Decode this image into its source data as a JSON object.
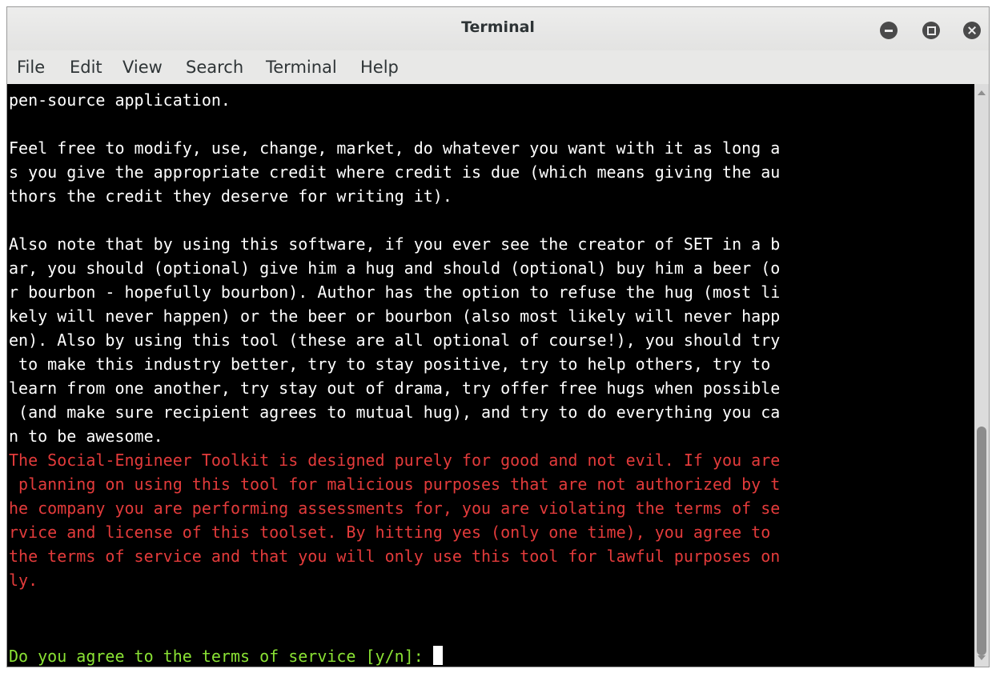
{
  "window": {
    "title": "Terminal"
  },
  "menu": {
    "items": [
      "File",
      "Edit",
      "View",
      "Search",
      "Terminal",
      "Help"
    ]
  },
  "terminal": {
    "colors": {
      "background": "#000000",
      "text": "#ffffff",
      "warning": "#e33b3b",
      "prompt": "#8ae234"
    },
    "lines": [
      "pen-source application.",
      "",
      "Feel free to modify, use, change, market, do whatever you want with it as long a",
      "s you give the appropriate credit where credit is due (which means giving the au",
      "thors the credit they deserve for writing it).",
      "",
      "Also note that by using this software, if you ever see the creator of SET in a b",
      "ar, you should (optional) give him a hug and should (optional) buy him a beer (o",
      "r bourbon - hopefully bourbon). Author has the option to refuse the hug (most li",
      "kely will never happen) or the beer or bourbon (also most likely will never happ",
      "en). Also by using this tool (these are all optional of course!), you should try",
      " to make this industry better, try to stay positive, try to help others, try to ",
      "learn from one another, try stay out of drama, try offer free hugs when possible",
      " (and make sure recipient agrees to mutual hug), and try to do everything you ca",
      "n to be awesome."
    ],
    "warning_lines": [
      "The Social-Engineer Toolkit is designed purely for good and not evil. If you are",
      " planning on using this tool for malicious purposes that are not authorized by t",
      "he company you are performing assessments for, you are violating the terms of se",
      "rvice and license of this toolset. By hitting yes (only one time), you agree to ",
      "the terms of service and that you will only use this tool for lawful purposes on",
      "ly."
    ],
    "prompt": "Do you agree to the terms of service [y/n]: "
  }
}
